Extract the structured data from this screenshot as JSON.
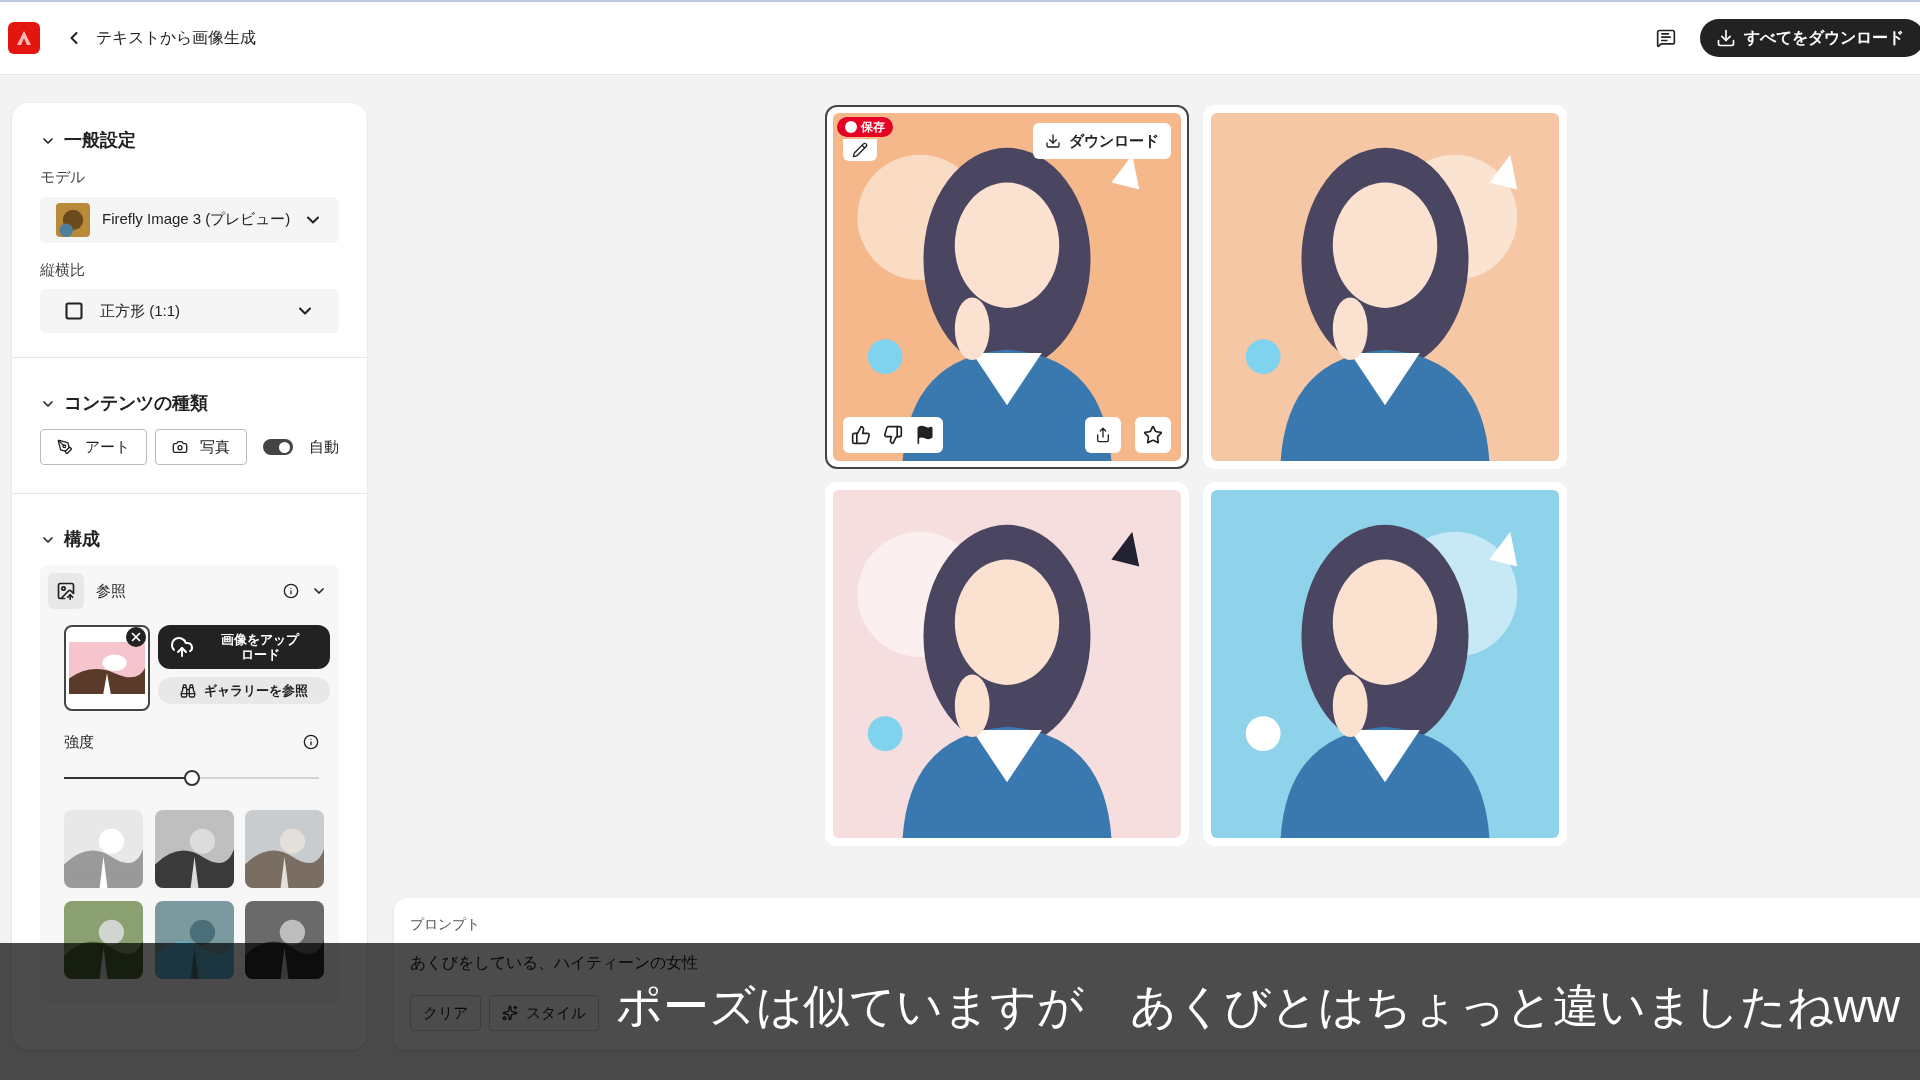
{
  "header": {
    "title": "テキストから画像生成",
    "download_all": "すべてをダウンロード"
  },
  "general": {
    "heading": "一般設定",
    "expanded": true,
    "model_label": "モデル",
    "model": "Firefly Image 3 (プレビュー)",
    "aspect_label": "縦横比",
    "aspect": "正方形 (1:1)"
  },
  "content_type": {
    "heading": "コンテンツの種類",
    "expanded": true,
    "options": [
      {
        "label": "アート",
        "kind": "art",
        "selected": false
      },
      {
        "label": "写真",
        "selected": false
      }
    ],
    "auto": {
      "label": "自動",
      "on": true
    }
  },
  "composition": {
    "heading": "構成",
    "expanded": true,
    "reference": {
      "label": "参照",
      "expanded": true,
      "upload": "画像をアップロード",
      "gallery": "ギャラリーを参照",
      "strength_label": "強度",
      "level": 0.5
    }
  },
  "results": [
    {
      "selected": true,
      "save": "保存",
      "download": "ダウンロード"
    },
    {
      "selected": false
    },
    {
      "selected": false
    },
    {
      "selected": false
    }
  ],
  "prompt": {
    "label": "プロンプト",
    "value": "あくびをしている、ハイティーンの女性",
    "chips": [
      {
        "label": "クリア",
        "kind": "clear"
      },
      {
        "label": "スタイル",
        "kind": "style"
      }
    ]
  },
  "subtitle": "ポーズは似ていますが　あくびとはちょっと違いましたねww"
}
